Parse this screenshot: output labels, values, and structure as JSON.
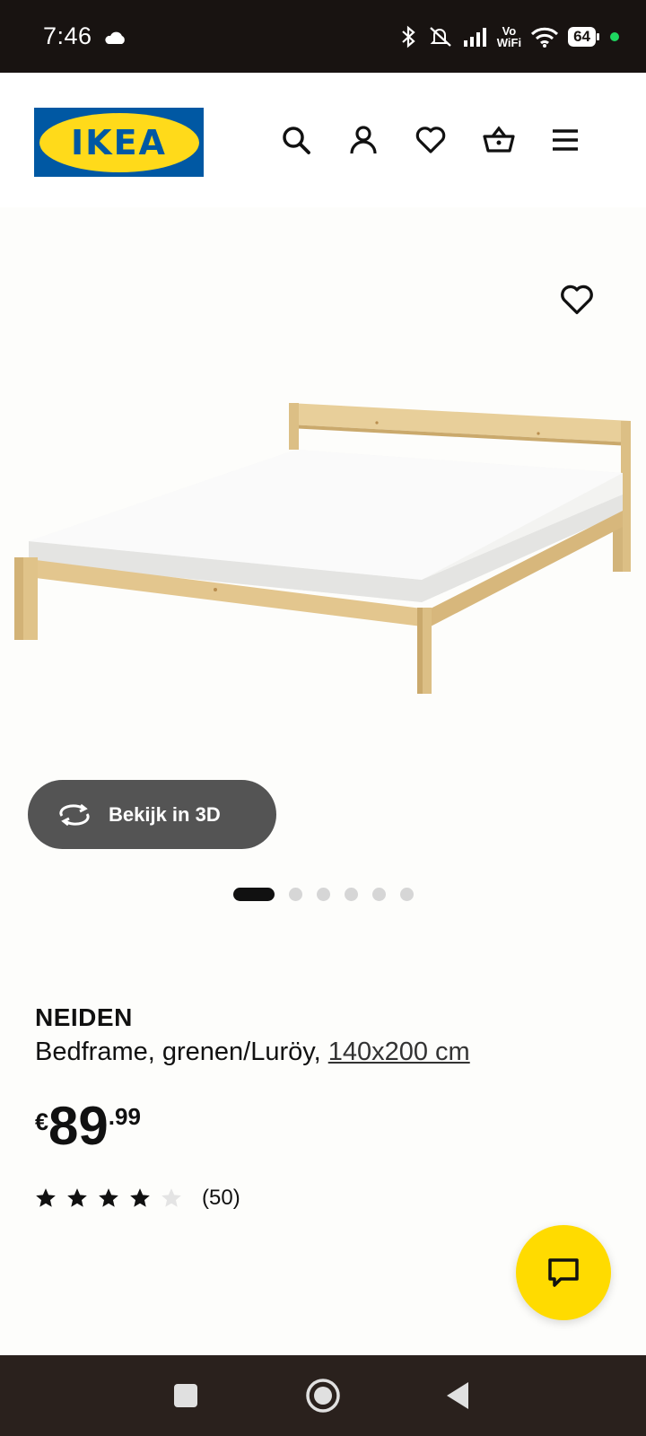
{
  "status_bar": {
    "time": "7:46",
    "vowifi": "Vo\nWiFi",
    "battery": "64"
  },
  "header": {
    "logo_text": "IKEA",
    "icons": [
      "search-icon",
      "account-icon",
      "wishlist-heart-icon",
      "shopping-basket-icon",
      "menu-icon"
    ]
  },
  "product": {
    "name": "NEIDEN",
    "description": "Bedframe, grenen/Luröy,",
    "size": "140x200 cm",
    "price_currency": "€",
    "price_integer": "89",
    "price_decimal": ".99",
    "rating_stars": 4,
    "rating_max": 5,
    "review_count": "(50)",
    "view_3d_label": "Bekijk in 3D",
    "image_count": 6,
    "active_image": 1
  },
  "colors": {
    "ikea_blue": "#0058a3",
    "ikea_yellow": "#ffda1a",
    "chat_yellow": "#ffdb00",
    "pill_bg": "#545454",
    "status_bg": "#181311",
    "nav_bg": "#2a211d"
  }
}
